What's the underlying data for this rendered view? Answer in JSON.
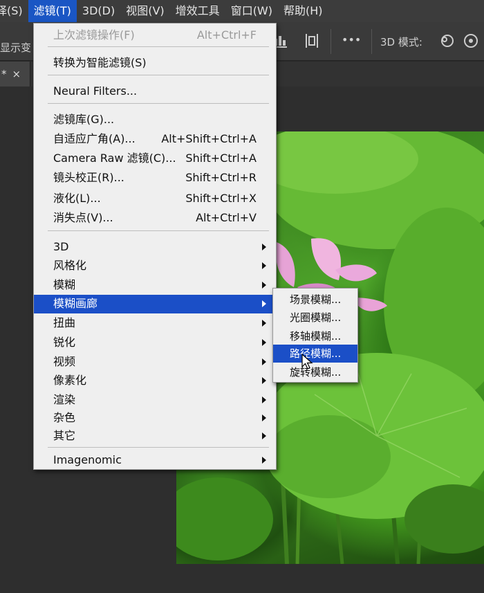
{
  "menubar": {
    "items": [
      "择(S)",
      "滤镜(T)",
      "3D(D)",
      "视图(V)",
      "增效工具",
      "窗口(W)",
      "帮助(H)"
    ],
    "active_index": 1
  },
  "options_bar": {
    "left_text": "显示变",
    "more_label": "•••",
    "mode_label": "3D 模式:"
  },
  "tab": {
    "title": "*",
    "close": "×"
  },
  "filter_menu": {
    "items": [
      {
        "label": "上次滤镜操作(F)",
        "shortcut": "Alt+Ctrl+F",
        "disabled": true
      },
      {
        "label": "转换为智能滤镜(S)"
      },
      {
        "label": "Neural Filters..."
      },
      {
        "label": "滤镜库(G)...",
        "shortcut": ""
      },
      {
        "label": "自适应广角(A)...",
        "shortcut": "Alt+Shift+Ctrl+A"
      },
      {
        "label": "Camera Raw 滤镜(C)...",
        "shortcut": "Shift+Ctrl+A"
      },
      {
        "label": "镜头校正(R)...",
        "shortcut": "Shift+Ctrl+R"
      },
      {
        "label": "液化(L)...",
        "shortcut": "Shift+Ctrl+X"
      },
      {
        "label": "消失点(V)...",
        "shortcut": "Alt+Ctrl+V"
      },
      {
        "label": "3D",
        "submenu": true
      },
      {
        "label": "风格化",
        "submenu": true
      },
      {
        "label": "模糊",
        "submenu": true
      },
      {
        "label": "模糊画廊",
        "submenu": true,
        "highlighted": true
      },
      {
        "label": "扭曲",
        "submenu": true
      },
      {
        "label": "锐化",
        "submenu": true
      },
      {
        "label": "视频",
        "submenu": true
      },
      {
        "label": "像素化",
        "submenu": true
      },
      {
        "label": "渲染",
        "submenu": true
      },
      {
        "label": "杂色",
        "submenu": true
      },
      {
        "label": "其它",
        "submenu": true
      },
      {
        "label": "Imagenomic",
        "submenu": true
      }
    ]
  },
  "blur_gallery_submenu": {
    "items": [
      {
        "label": "场景模糊..."
      },
      {
        "label": "光圈模糊..."
      },
      {
        "label": "移轴模糊..."
      },
      {
        "label": "路径模糊...",
        "highlighted": true
      },
      {
        "label": "旋转模糊..."
      }
    ]
  },
  "colors": {
    "highlight": "#1b4fc7",
    "menu_bg": "#efefef",
    "app_bg": "#2a2a2a"
  }
}
